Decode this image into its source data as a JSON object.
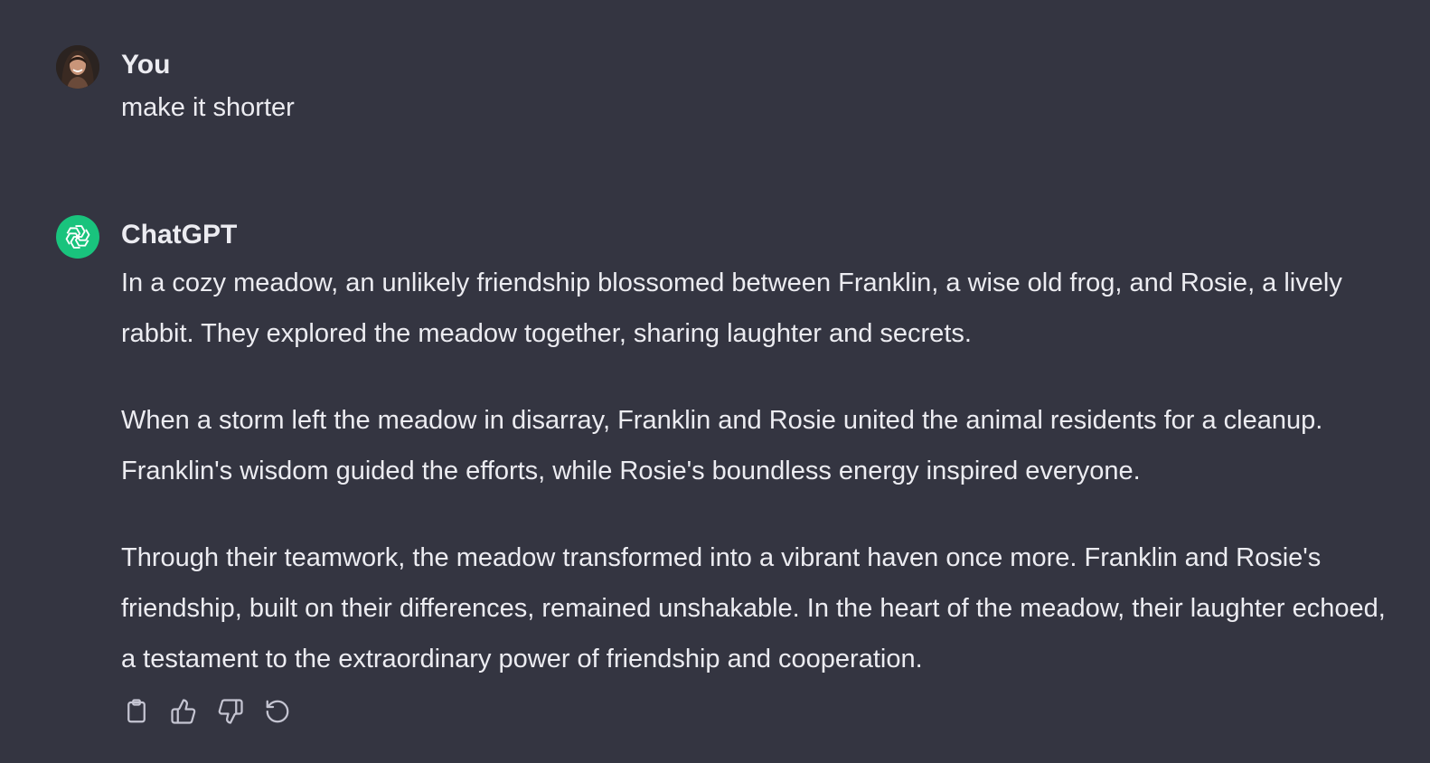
{
  "messages": [
    {
      "role": "user",
      "author": "You",
      "avatar_icon": "user-avatar",
      "text": "make it shorter"
    },
    {
      "role": "assistant",
      "author": "ChatGPT",
      "avatar_icon": "openai-logo-icon",
      "paragraphs": [
        "In a cozy meadow, an unlikely friendship blossomed between Franklin, a wise old frog, and Rosie, a lively rabbit. They explored the meadow together, sharing laughter and secrets.",
        "When a storm left the meadow in disarray, Franklin and Rosie united the animal residents for a cleanup. Franklin's wisdom guided the efforts, while Rosie's boundless energy inspired everyone.",
        "Through their teamwork, the meadow transformed into a vibrant haven once more. Franklin and Rosie's friendship, built on their differences, remained unshakable. In the heart of the meadow, their laughter echoed, a testament to the extraordinary power of friendship and cooperation."
      ]
    }
  ],
  "actions": [
    {
      "icon": "clipboard-icon"
    },
    {
      "icon": "thumbs-up-icon"
    },
    {
      "icon": "thumbs-down-icon"
    },
    {
      "icon": "regenerate-icon"
    }
  ],
  "colors": {
    "background": "#343541",
    "text": "#ececf1",
    "accent": "#19c37d",
    "icon": "#c5c5d2"
  }
}
